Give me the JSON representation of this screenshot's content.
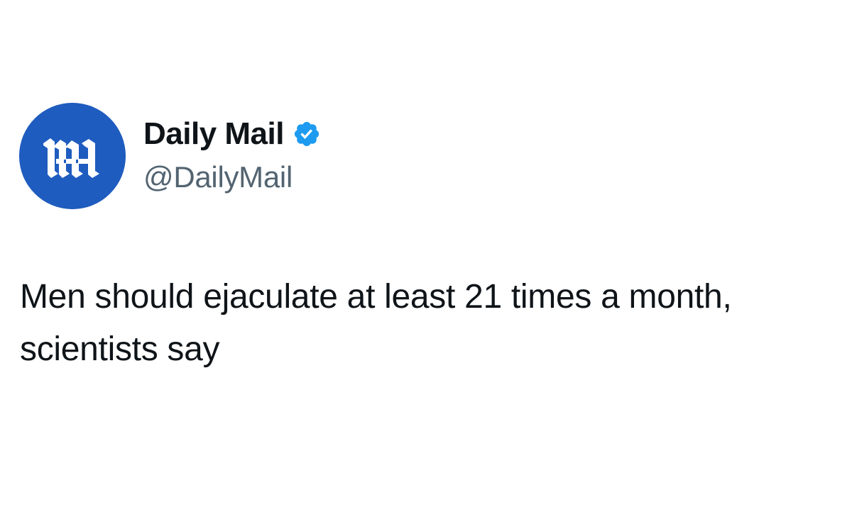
{
  "account": {
    "display_name": "Daily Mail",
    "handle": "@DailyMail",
    "verified": true,
    "avatar_icon": "daily-mail-logo-icon",
    "verified_icon": "verified-badge-icon"
  },
  "tweet": {
    "text": "Men should ejaculate at least 21 times a month, scientists say"
  },
  "colors": {
    "avatar_background": "#1f5cbf",
    "verified_blue": "#1d9bf0",
    "handle_gray": "#536471",
    "text": "#0f1419"
  }
}
